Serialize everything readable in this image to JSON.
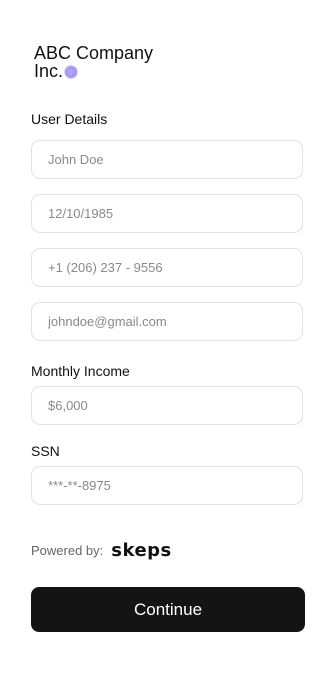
{
  "brand": {
    "line1": "ABC Company",
    "line2": "Inc.",
    "accent_color": "#a395ef"
  },
  "user_details": {
    "heading": "User Details",
    "name_placeholder": "John Doe",
    "dob_placeholder": "12/10/1985",
    "phone_placeholder": "+1 (206) 237 - 9556",
    "email_placeholder": "johndoe@gmail.com"
  },
  "income": {
    "heading": "Monthly Income",
    "placeholder": "$6,000"
  },
  "ssn": {
    "heading": "SSN",
    "placeholder": "***-**-8975"
  },
  "footer": {
    "powered_by": "Powered by:",
    "logo_text": "skeps"
  },
  "actions": {
    "continue_label": "Continue",
    "button_color": "#141414"
  }
}
